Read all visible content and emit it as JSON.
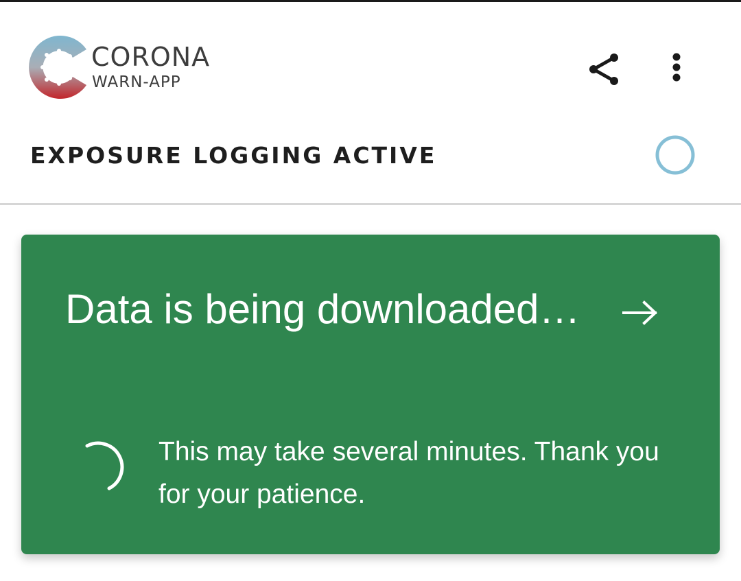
{
  "header": {
    "brand_name": "CORONA",
    "brand_subtitle": "WARN-APP",
    "share_icon": "share-icon",
    "more_icon": "more-vertical-icon"
  },
  "tracing_status": {
    "label": "EXPOSURE LOGGING ACTIVE",
    "indicator_icon": "status-ring-icon",
    "indicator_color": "#86bfd6"
  },
  "risk_card": {
    "background_color": "#2f864f",
    "title": "Data is being downloaded…",
    "arrow_icon": "arrow-right-icon",
    "spinner_icon": "loading-spinner-icon",
    "body": "This may take several minutes. Thank you for your patience."
  }
}
